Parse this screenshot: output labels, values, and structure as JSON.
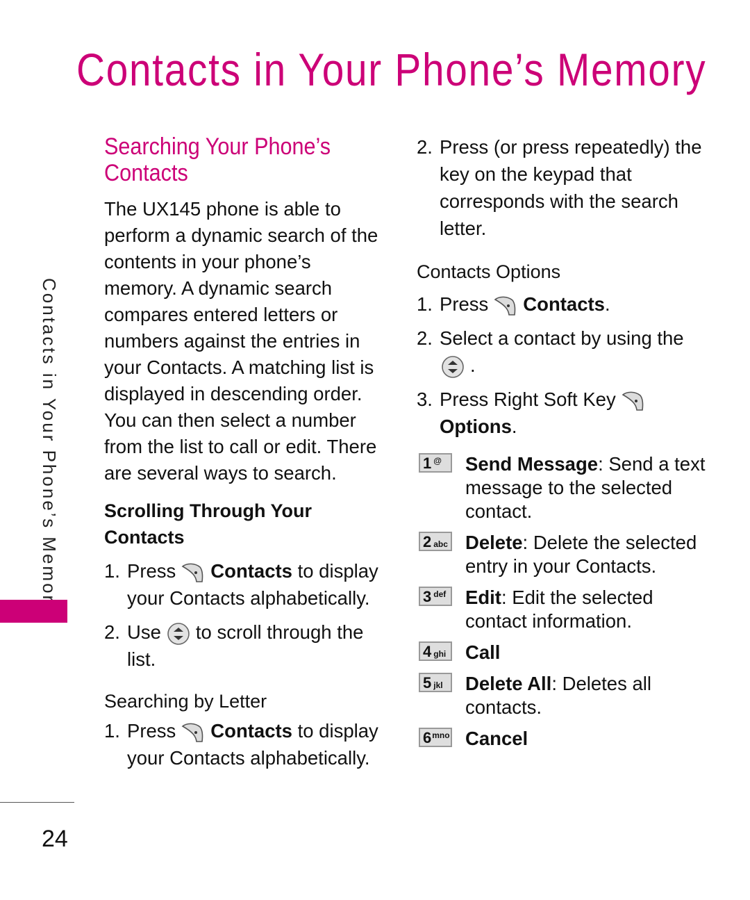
{
  "page": {
    "title": "Contacts in Your Phone’s Memory",
    "side_tab": "Contacts in Your Phone’s Memory",
    "page_number": "24",
    "accent_color": "#cc0077"
  },
  "left": {
    "section_title_line1": "Searching Your Phone’s",
    "section_title_line2": "Contacts",
    "intro": "The UX145 phone is able to perform a dynamic search of the contents in your phone’s memory. A dynamic search compares entered letters or numbers against the entries in your Contacts. A matching list is displayed in descending order. You can then select a number from the list to call or edit. There are several ways to search.",
    "scrolling": {
      "heading_line1": "Scrolling Through Your",
      "heading_line2": "Contacts",
      "steps": [
        {
          "num": "1.",
          "pre": "Press",
          "icon": "right-soft-key-icon",
          "bold": "Contacts",
          "post": "to display your Contacts alphabetically."
        },
        {
          "num": "2.",
          "pre": "Use",
          "icon": "navigation-key-icon",
          "post": "to scroll through the list."
        }
      ]
    },
    "by_letter": {
      "heading": "Searching by Letter",
      "steps": [
        {
          "num": "1.",
          "pre": "Press",
          "icon": "right-soft-key-icon",
          "bold": "Contacts",
          "post": "to display your Contacts alphabetically."
        }
      ]
    }
  },
  "right": {
    "letter_step2": {
      "num": "2.",
      "text": "Press (or press repeatedly) the key on the keypad that corresponds with the search letter."
    },
    "options_heading": "Contacts Options",
    "options_steps": [
      {
        "num": "1.",
        "pre": "Press",
        "icon": "right-soft-key-icon",
        "bold": "Contacts",
        "post": "."
      },
      {
        "num": "2.",
        "pre": "Select a contact by using the",
        "icon": "navigation-key-icon",
        "post": "."
      },
      {
        "num": "3.",
        "pre": "Press Right Soft Key",
        "icon": "right-soft-key-icon",
        "bold": "Options",
        "post": "."
      }
    ],
    "menu_options": [
      {
        "key": "1",
        "letters": "@",
        "label": "Send Message",
        "desc": ": Send a text message to the selected contact."
      },
      {
        "key": "2",
        "letters": "abc",
        "label": "Delete",
        "desc": ": Delete the selected entry in your Contacts."
      },
      {
        "key": "3",
        "letters": "def",
        "label": "Edit",
        "desc": ": Edit the selected contact information."
      },
      {
        "key": "4",
        "letters": "ghi",
        "label": "Call",
        "desc": ""
      },
      {
        "key": "5",
        "letters": "jkl",
        "label": "Delete All",
        "desc": ": Deletes all contacts."
      },
      {
        "key": "6",
        "letters": "mno",
        "label": "Cancel",
        "desc": ""
      }
    ]
  }
}
